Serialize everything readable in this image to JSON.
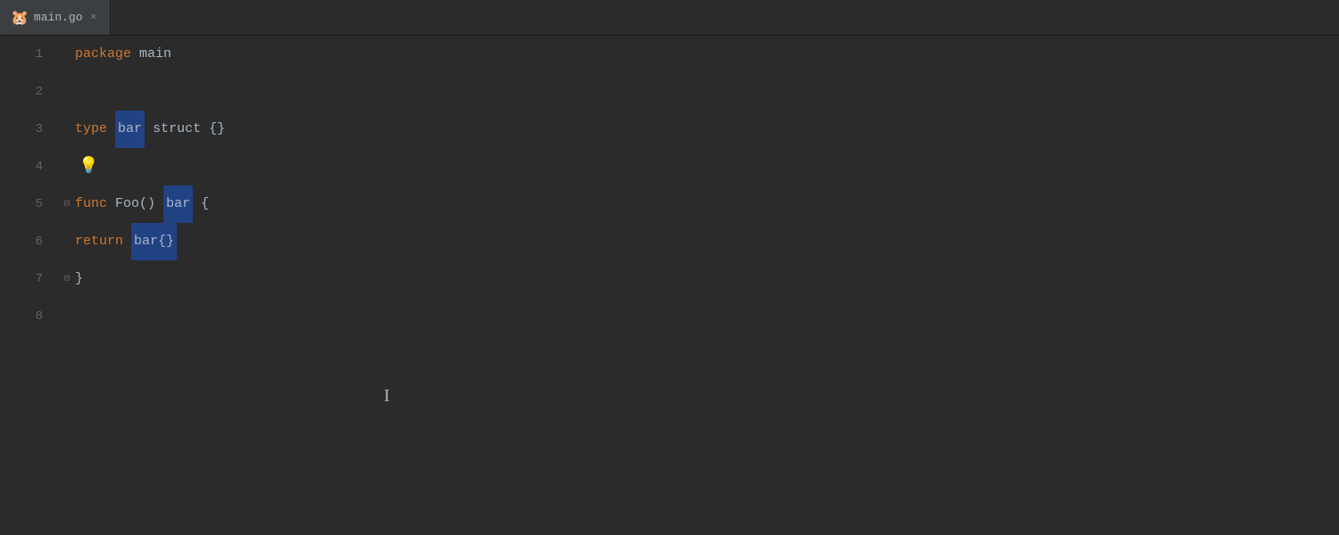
{
  "tab": {
    "icon": "🐹",
    "filename": "main.go",
    "close_label": "×"
  },
  "editor": {
    "lines": [
      {
        "number": "1",
        "tokens": [
          {
            "text": "package",
            "class": "c-keyword"
          },
          {
            "text": " "
          },
          {
            "text": "main",
            "class": "c-type-name"
          }
        ],
        "fold": null,
        "active": false
      },
      {
        "number": "2",
        "tokens": [],
        "fold": null,
        "active": false
      },
      {
        "number": "3",
        "tokens": [
          {
            "text": "type",
            "class": "c-keyword"
          },
          {
            "text": " "
          },
          {
            "text": "bar",
            "class": "c-highlighted-bar"
          },
          {
            "text": " "
          },
          {
            "text": "struct",
            "class": "c-struct"
          },
          {
            "text": " "
          },
          {
            "text": "{}",
            "class": "c-braces"
          }
        ],
        "fold": null,
        "active": false
      },
      {
        "number": "4",
        "tokens": [
          {
            "text": "💡",
            "class": "lightbulb"
          }
        ],
        "fold": null,
        "active": false
      },
      {
        "number": "5",
        "tokens": [
          {
            "text": "func",
            "class": "c-keyword"
          },
          {
            "text": " "
          },
          {
            "text": "Foo",
            "class": "c-func-name"
          },
          {
            "text": "()",
            "class": "c-parens"
          },
          {
            "text": " "
          },
          {
            "text": "bar",
            "class": "c-bar-highlight"
          },
          {
            "text": " "
          },
          {
            "text": "{",
            "class": "c-braces"
          }
        ],
        "fold": "minus",
        "active": false
      },
      {
        "number": "6",
        "tokens": [
          {
            "text": "    return",
            "class": "c-return-keyword"
          },
          {
            "text": " "
          },
          {
            "text": "bar{}",
            "class": "c-bar-highlight"
          }
        ],
        "fold": null,
        "active": false
      },
      {
        "number": "7",
        "tokens": [
          {
            "text": "}",
            "class": "c-braces"
          }
        ],
        "fold": "minus",
        "active": false
      },
      {
        "number": "8",
        "tokens": [],
        "fold": null,
        "active": false
      }
    ]
  }
}
